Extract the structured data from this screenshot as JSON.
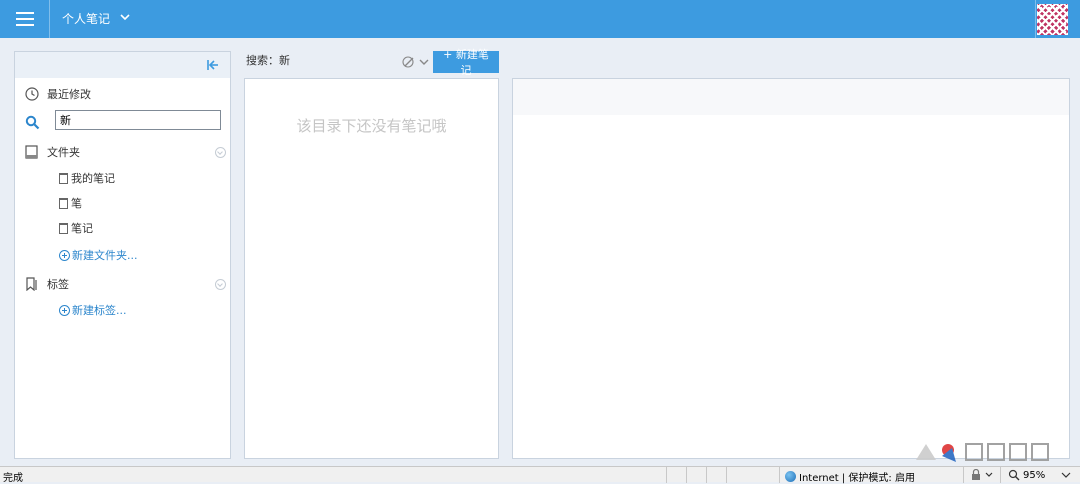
{
  "header": {
    "notebook_title": "个人笔记"
  },
  "sidebar": {
    "recent_label": "最近修改",
    "search_value": "新",
    "folders_label": "文件夹",
    "folders": [
      {
        "label": "我的笔记"
      },
      {
        "label": "笔"
      },
      {
        "label": "笔记"
      }
    ],
    "new_folder_label": "新建文件夹...",
    "tags_label": "标签",
    "new_tag_label": "新建标签..."
  },
  "notelist": {
    "search_label": "搜索：新",
    "new_note_label": "+ 新建笔记",
    "empty_message": "该目录下还没有笔记哦"
  },
  "statusbar": {
    "status_text": "完成",
    "zone_text": "Internet | 保护模式: 启用",
    "zoom": "95%"
  },
  "colors": {
    "accent": "#3d9be0",
    "link": "#2c86cc",
    "avatar": "#c03464"
  }
}
